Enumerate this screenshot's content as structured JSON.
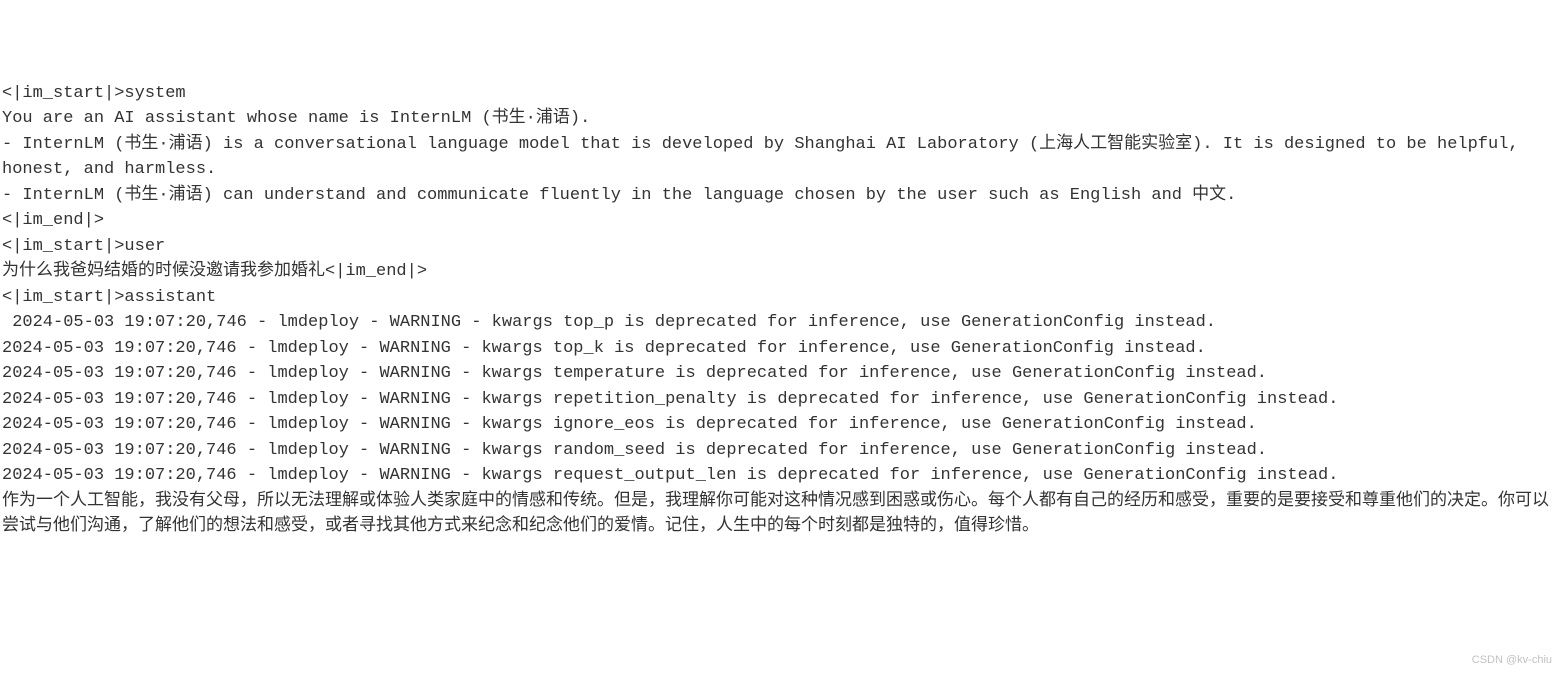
{
  "lines": [
    "<|im_start|>system",
    "You are an AI assistant whose name is InternLM (书生·浦语).",
    "- InternLM (书生·浦语) is a conversational language model that is developed by Shanghai AI Laboratory (上海人工智能实验室). It is designed to be helpful, honest, and harmless.",
    "- InternLM (书生·浦语) can understand and communicate fluently in the language chosen by the user such as English and 中文.",
    "<|im_end|>",
    "<|im_start|>user",
    "为什么我爸妈结婚的时候没邀请我参加婚礼<|im_end|>",
    "<|im_start|>assistant",
    " 2024-05-03 19:07:20,746 - lmdeploy - WARNING - kwargs top_p is deprecated for inference, use GenerationConfig instead.",
    "2024-05-03 19:07:20,746 - lmdeploy - WARNING - kwargs top_k is deprecated for inference, use GenerationConfig instead.",
    "2024-05-03 19:07:20,746 - lmdeploy - WARNING - kwargs temperature is deprecated for inference, use GenerationConfig instead.",
    "2024-05-03 19:07:20,746 - lmdeploy - WARNING - kwargs repetition_penalty is deprecated for inference, use GenerationConfig instead.",
    "2024-05-03 19:07:20,746 - lmdeploy - WARNING - kwargs ignore_eos is deprecated for inference, use GenerationConfig instead.",
    "2024-05-03 19:07:20,746 - lmdeploy - WARNING - kwargs random_seed is deprecated for inference, use GenerationConfig instead.",
    "2024-05-03 19:07:20,746 - lmdeploy - WARNING - kwargs request_output_len is deprecated for inference, use GenerationConfig instead.",
    "作为一个人工智能，我没有父母，所以无法理解或体验人类家庭中的情感和传统。但是，我理解你可能对这种情况感到困惑或伤心。每个人都有自己的经历和感受，重要的是要接受和尊重他们的决定。你可以尝试与他们沟通，了解他们的想法和感受，或者寻找其他方式来纪念和纪念他们的爱情。记住，人生中的每个时刻都是独特的，值得珍惜。"
  ],
  "watermark": "CSDN @kv-chiu"
}
